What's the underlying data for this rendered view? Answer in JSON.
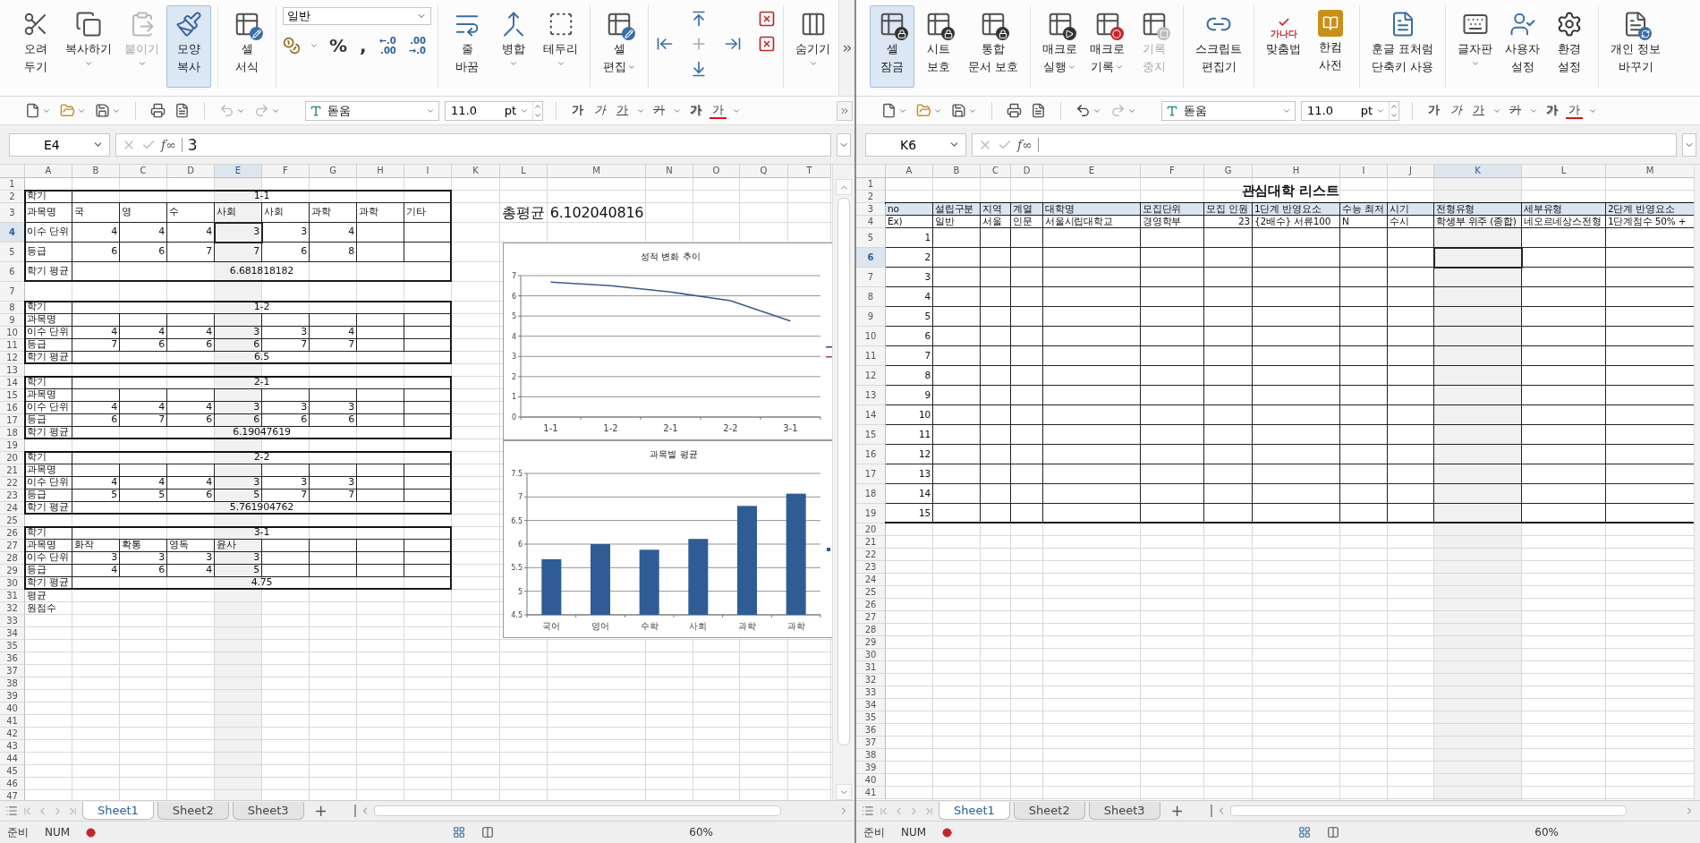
{
  "panes": [
    {
      "ribbon": {
        "groups": [
          {
            "items": [
              {
                "kind": "button",
                "lines": [
                  "오려",
                  "두기"
                ],
                "caret_below": false,
                "caret_inline": false,
                "selected": false,
                "disabled": false
              },
              {
                "kind": "button",
                "lines": [
                  "복사하기"
                ],
                "caret_below": true,
                "caret_inline": false,
                "selected": false,
                "disabled": false
              },
              {
                "kind": "button",
                "lines": [
                  "붙이기"
                ],
                "caret_below": true,
                "caret_inline": false,
                "selected": false,
                "disabled": true
              },
              {
                "kind": "button",
                "lines": [
                  "모양",
                  "복사"
                ],
                "caret_below": false,
                "caret_inline": false,
                "selected": true,
                "disabled": false
              }
            ]
          },
          {
            "items": [
              {
                "kind": "button",
                "lines": [
                  "셀",
                  "서식"
                ],
                "caret_below": false,
                "caret_inline": false,
                "selected": false,
                "disabled": false
              }
            ]
          },
          {
            "items": [
              {
                "kind": "number-format",
                "format": "일반",
                "symbols": [
                  "%",
                  ","
                ],
                "decimals": [
                  {
                    "top": "←.0",
                    "bottom": ".00"
                  },
                  {
                    "top": ".00",
                    "bottom": "→.0"
                  }
                ]
              }
            ]
          },
          {
            "items": [
              {
                "kind": "button",
                "lines": [
                  "줄",
                  "바꿈"
                ],
                "caret_below": false,
                "caret_inline": false,
                "selected": false,
                "disabled": false
              },
              {
                "kind": "button",
                "lines": [
                  "병합"
                ],
                "caret_below": true,
                "caret_inline": false,
                "selected": false,
                "disabled": false
              },
              {
                "kind": "button",
                "lines": [
                  "테두리"
                ],
                "caret_below": true,
                "caret_inline": false,
                "selected": false,
                "disabled": false
              }
            ]
          },
          {
            "items": [
              {
                "kind": "button",
                "lines": [
                  "셀",
                  "편집"
                ],
                "caret_below": false,
                "caret_inline": true,
                "selected": false,
                "disabled": false
              }
            ]
          },
          {
            "items": [
              {
                "kind": "insert-delete-grid"
              }
            ]
          },
          {
            "items": [
              {
                "kind": "button",
                "lines": [
                  "숨기기"
                ],
                "caret_below": true,
                "caret_inline": false,
                "selected": false,
                "disabled": false
              }
            ]
          }
        ],
        "overflow_button": true
      },
      "toolbar": {
        "undo": {
          "disabled": true
        },
        "redo": {
          "disabled": true
        },
        "font": "돋움",
        "size": "11.0",
        "unit": "pt",
        "overflow_button": true,
        "styles": [
          {
            "kind": "bold",
            "label": "가"
          },
          {
            "kind": "italic",
            "label": "가"
          },
          {
            "kind": "underline",
            "label": "가"
          },
          {
            "kind": "strike",
            "label": "가"
          },
          {
            "kind": "shadow",
            "label": "가"
          },
          {
            "kind": "color",
            "label": "가"
          }
        ]
      },
      "formula_bar": {
        "cell": "E4",
        "function_label": "f∞",
        "value": "3"
      },
      "sheet": {
        "kind": "grades",
        "columns": [
          {
            "label": "A",
            "selected": false
          },
          {
            "label": "B",
            "selected": false
          },
          {
            "label": "C",
            "selected": false
          },
          {
            "label": "D",
            "selected": false
          },
          {
            "label": "E",
            "selected": true
          },
          {
            "label": "F",
            "selected": false
          },
          {
            "label": "G",
            "selected": false
          },
          {
            "label": "H",
            "selected": false
          },
          {
            "label": "I",
            "selected": false
          },
          {
            "label": "K",
            "selected": false
          },
          {
            "label": "L",
            "selected": false
          },
          {
            "label": "M",
            "selected": false
          },
          {
            "label": "N",
            "selected": false
          },
          {
            "label": "O",
            "selected": false
          },
          {
            "label": "Q",
            "selected": false
          },
          {
            "label": "T",
            "selected": false
          }
        ],
        "row_headers": [
          {
            "label": "1",
            "selected": false
          },
          {
            "label": "2",
            "selected": false
          },
          {
            "label": "3",
            "selected": false
          },
          {
            "label": "4",
            "selected": true
          },
          {
            "label": "5",
            "selected": false
          },
          {
            "label": "6",
            "selected": false
          },
          {
            "label": "7",
            "selected": false
          },
          {
            "label": "8",
            "selected": false
          },
          {
            "label": "9",
            "selected": false
          },
          {
            "label": "10",
            "selected": false
          },
          {
            "label": "11",
            "selected": false
          },
          {
            "label": "12",
            "selected": false
          },
          {
            "label": "13",
            "selected": false
          },
          {
            "label": "14",
            "selected": false
          },
          {
            "label": "15",
            "selected": false
          },
          {
            "label": "16",
            "selected": false
          },
          {
            "label": "17",
            "selected": false
          },
          {
            "label": "18",
            "selected": false
          },
          {
            "label": "19",
            "selected": false
          },
          {
            "label": "20",
            "selected": false
          },
          {
            "label": "21",
            "selected": false
          },
          {
            "label": "22",
            "selected": false
          },
          {
            "label": "23",
            "selected": false
          },
          {
            "label": "24",
            "selected": false
          },
          {
            "label": "25",
            "selected": false
          },
          {
            "label": "26",
            "selected": false
          },
          {
            "label": "27",
            "selected": false
          },
          {
            "label": "28",
            "selected": false
          },
          {
            "label": "29",
            "selected": false
          },
          {
            "label": "30",
            "selected": false
          },
          {
            "label": "31",
            "selected": false
          },
          {
            "label": "32",
            "selected": false
          },
          {
            "label": "33",
            "selected": false
          },
          {
            "label": "34",
            "selected": false
          },
          {
            "label": "35",
            "selected": false
          },
          {
            "label": "36",
            "selected": false
          },
          {
            "label": "37",
            "selected": false
          },
          {
            "label": "38",
            "selected": false
          },
          {
            "label": "39",
            "selected": false
          },
          {
            "label": "40",
            "selected": false
          },
          {
            "label": "41",
            "selected": false
          },
          {
            "label": "42",
            "selected": false
          },
          {
            "label": "43",
            "selected": false
          },
          {
            "label": "44",
            "selected": false
          },
          {
            "label": "45",
            "selected": false
          },
          {
            "label": "46",
            "selected": false
          },
          {
            "label": "47",
            "selected": false
          }
        ],
        "blocks": [
          {
            "header": "학기",
            "semester": "1-1",
            "subject_label": "과목명",
            "subjects": [
              "국",
              "영",
              "수",
              "사회",
              "사회",
              "과학",
              "과학",
              "기타"
            ],
            "rows": [
              {
                "label": "이수 단위",
                "values": [
                  "4",
                  "4",
                  "4",
                  "3",
                  "3",
                  "4"
                ]
              },
              {
                "label": "등급",
                "values": [
                  "6",
                  "6",
                  "7",
                  "7",
                  "6",
                  "8"
                ]
              }
            ],
            "avg_label": "학기 평균",
            "average": "6.681818182"
          },
          {
            "header": "학기",
            "semester": "1-2",
            "subject_label": "과목명",
            "rows": [
              {
                "label": "이수 단위",
                "values": [
                  "4",
                  "4",
                  "4",
                  "3",
                  "3",
                  "4"
                ]
              },
              {
                "label": "등급",
                "values": [
                  "7",
                  "6",
                  "6",
                  "6",
                  "7",
                  "7"
                ]
              }
            ],
            "avg_label": "학기 평균",
            "average": "6.5"
          },
          {
            "header": "학기",
            "semester": "2-1",
            "subject_label": "과목명",
            "rows": [
              {
                "label": "이수 단위",
                "values": [
                  "4",
                  "4",
                  "4",
                  "3",
                  "3",
                  "3"
                ]
              },
              {
                "label": "등급",
                "values": [
                  "6",
                  "7",
                  "6",
                  "6",
                  "6",
                  "6"
                ]
              }
            ],
            "avg_label": "학기 평균",
            "average": "6.19047619"
          },
          {
            "header": "학기",
            "semester": "2-2",
            "subject_label": "과목명",
            "rows": [
              {
                "label": "이수 단위",
                "values": [
                  "4",
                  "4",
                  "4",
                  "3",
                  "3",
                  "3"
                ]
              },
              {
                "label": "등급",
                "values": [
                  "5",
                  "5",
                  "6",
                  "5",
                  "7",
                  "7"
                ]
              }
            ],
            "avg_label": "학기 평균",
            "average": "5.761904762"
          },
          {
            "header": "학기",
            "semester": "3-1",
            "subject_label": "과목명",
            "subjects": [
              "화작",
              "확통",
              "영독",
              "윤사"
            ],
            "rows": [
              {
                "label": "이수 단위",
                "values": [
                  "3",
                  "3",
                  "3",
                  "3"
                ]
              },
              {
                "label": "등급",
                "values": [
                  "4",
                  "6",
                  "4",
                  "5"
                ]
              }
            ],
            "avg_label": "학기 평균",
            "average": "4.75"
          }
        ],
        "total": {
          "label": "총평균",
          "value": "6.102040816"
        },
        "footer_labels": [
          "평균",
          "원점수"
        ],
        "charts": [
          {
            "chart_data": {
              "type": "line",
              "title": "성적 변화 추이",
              "categories": [
                "1-1",
                "1-2",
                "2-1",
                "2-2",
                "3-1"
              ],
              "ylim": [
                0,
                7
              ],
              "yticks": [
                0,
                1,
                2,
                3,
                4,
                5,
                6,
                7
              ],
              "grid": true,
              "series": [
                {
                  "color": "#3b5b8c",
                  "values": [
                    6.68,
                    6.5,
                    6.19,
                    5.76,
                    4.75
                  ]
                },
                {
                  "color": "#b0504d",
                  "values": [
                    null,
                    null,
                    null,
                    null,
                    null
                  ]
                }
              ]
            }
          },
          {
            "chart_data": {
              "type": "bar",
              "title": "과목별 평균",
              "categories": [
                "국어",
                "영어",
                "수학",
                "사회",
                "과학",
                "과학"
              ],
              "ylim": [
                4.5,
                7.5
              ],
              "yticks": [
                4.5,
                5,
                5.5,
                6,
                6.5,
                7,
                7.5
              ],
              "grid": true,
              "series": [
                {
                  "color": "#2f5c94",
                  "values": [
                    5.68,
                    6.0,
                    5.88,
                    6.11,
                    6.81,
                    7.07
                  ]
                }
              ]
            }
          }
        ]
      },
      "tabs": {
        "sheets": [
          {
            "label": "Sheet1",
            "selected": true
          },
          {
            "label": "Sheet2",
            "selected": false
          },
          {
            "label": "Sheet3",
            "selected": false
          }
        ],
        "add_label": "+"
      },
      "status": {
        "mode": "준비",
        "num": "NUM",
        "zoom": "60%"
      }
    },
    {
      "ribbon": {
        "groups": [
          {
            "items": [
              {
                "kind": "button",
                "lines": [
                  "셀",
                  "잠금"
                ],
                "caret_below": false,
                "caret_inline": false,
                "selected": true,
                "disabled": false
              },
              {
                "kind": "button",
                "lines": [
                  "시트",
                  "보호"
                ],
                "caret_below": false,
                "caret_inline": false,
                "selected": false,
                "disabled": false
              },
              {
                "kind": "button",
                "lines": [
                  "통합",
                  "문서 보호"
                ],
                "caret_below": false,
                "caret_inline": false,
                "selected": false,
                "disabled": false
              }
            ]
          },
          {
            "items": [
              {
                "kind": "button",
                "lines": [
                  "매크로",
                  "실행"
                ],
                "caret_below": false,
                "caret_inline": true,
                "selected": false,
                "disabled": false
              },
              {
                "kind": "button",
                "lines": [
                  "매크로",
                  "기록"
                ],
                "caret_below": false,
                "caret_inline": true,
                "selected": false,
                "disabled": false
              },
              {
                "kind": "button",
                "lines": [
                  "기록",
                  "중지"
                ],
                "caret_below": false,
                "caret_inline": false,
                "selected": false,
                "disabled": true
              }
            ]
          },
          {
            "items": [
              {
                "kind": "button",
                "lines": [
                  "스크립트",
                  "편집기"
                ],
                "caret_below": false,
                "caret_inline": false,
                "selected": false,
                "disabled": false
              }
            ]
          },
          {
            "items": [
              {
                "kind": "button",
                "lines": [
                  "맞춤법"
                ],
                "icon_text": "가나다",
                "caret_below": false,
                "caret_inline": false,
                "selected": false,
                "disabled": false
              },
              {
                "kind": "button",
                "lines": [
                  "한컴",
                  "사전"
                ],
                "caret_below": false,
                "caret_inline": false,
                "selected": false,
                "disabled": false
              }
            ]
          },
          {
            "items": [
              {
                "kind": "button",
                "lines": [
                  "훈글 표처럼",
                  "단축키 사용"
                ],
                "caret_below": false,
                "caret_inline": false,
                "selected": false,
                "disabled": false
              }
            ]
          },
          {
            "items": [
              {
                "kind": "button",
                "lines": [
                  "글자판"
                ],
                "caret_below": true,
                "caret_inline": false,
                "selected": false,
                "disabled": false
              },
              {
                "kind": "button",
                "lines": [
                  "사용자",
                  "설정"
                ],
                "caret_below": false,
                "caret_inline": false,
                "selected": false,
                "disabled": false
              },
              {
                "kind": "button",
                "lines": [
                  "환경",
                  "설정"
                ],
                "caret_below": false,
                "caret_inline": false,
                "selected": false,
                "disabled": false
              }
            ]
          },
          {
            "items": [
              {
                "kind": "button",
                "lines": [
                  "개인 정보",
                  "바꾸기"
                ],
                "caret_below": false,
                "caret_inline": false,
                "selected": false,
                "disabled": false
              }
            ]
          }
        ]
      },
      "toolbar": {
        "undo": {
          "disabled": false
        },
        "redo": {
          "disabled": true
        },
        "font": "돋움",
        "size": "11.0",
        "unit": "pt",
        "styles": [
          {
            "kind": "bold",
            "label": "가"
          },
          {
            "kind": "italic",
            "label": "가"
          },
          {
            "kind": "underline",
            "label": "가"
          },
          {
            "kind": "strike",
            "label": "가"
          },
          {
            "kind": "shadow",
            "label": "가"
          },
          {
            "kind": "color",
            "label": "가"
          }
        ]
      },
      "formula_bar": {
        "cell": "K6",
        "function_label": "f∞"
      },
      "sheet": {
        "kind": "list",
        "columns": [
          {
            "label": "A",
            "selected": false
          },
          {
            "label": "B",
            "selected": false
          },
          {
            "label": "C",
            "selected": false
          },
          {
            "label": "D",
            "selected": false
          },
          {
            "label": "E",
            "selected": false
          },
          {
            "label": "F",
            "selected": false
          },
          {
            "label": "G",
            "selected": false
          },
          {
            "label": "H",
            "selected": false
          },
          {
            "label": "I",
            "selected": false
          },
          {
            "label": "J",
            "selected": false
          },
          {
            "label": "K",
            "selected": true
          },
          {
            "label": "L",
            "selected": false
          },
          {
            "label": "M",
            "selected": false
          }
        ],
        "row_headers": [
          {
            "label": "1",
            "selected": false
          },
          {
            "label": "2",
            "selected": false
          },
          {
            "label": "3",
            "selected": false
          },
          {
            "label": "4",
            "selected": false
          },
          {
            "label": "5",
            "selected": false
          },
          {
            "label": "6",
            "selected": true
          },
          {
            "label": "7",
            "selected": false
          },
          {
            "label": "8",
            "selected": false
          },
          {
            "label": "9",
            "selected": false
          },
          {
            "label": "10",
            "selected": false
          },
          {
            "label": "11",
            "selected": false
          },
          {
            "label": "12",
            "selected": false
          },
          {
            "label": "13",
            "selected": false
          },
          {
            "label": "14",
            "selected": false
          },
          {
            "label": "15",
            "selected": false
          },
          {
            "label": "16",
            "selected": false
          },
          {
            "label": "17",
            "selected": false
          },
          {
            "label": "18",
            "selected": false
          },
          {
            "label": "19",
            "selected": false
          },
          {
            "label": "20",
            "selected": false
          },
          {
            "label": "21",
            "selected": false
          },
          {
            "label": "22",
            "selected": false
          },
          {
            "label": "23",
            "selected": false
          },
          {
            "label": "24",
            "selected": false
          },
          {
            "label": "25",
            "selected": false
          },
          {
            "label": "26",
            "selected": false
          },
          {
            "label": "27",
            "selected": false
          },
          {
            "label": "28",
            "selected": false
          },
          {
            "label": "29",
            "selected": false
          },
          {
            "label": "30",
            "selected": false
          },
          {
            "label": "31",
            "selected": false
          },
          {
            "label": "32",
            "selected": false
          },
          {
            "label": "33",
            "selected": false
          },
          {
            "label": "34",
            "selected": false
          },
          {
            "label": "35",
            "selected": false
          },
          {
            "label": "36",
            "selected": false
          },
          {
            "label": "37",
            "selected": false
          },
          {
            "label": "38",
            "selected": false
          },
          {
            "label": "39",
            "selected": false
          },
          {
            "label": "40",
            "selected": false
          },
          {
            "label": "41",
            "selected": false
          }
        ],
        "title": "관심대학 리스트",
        "header_row": [
          "no",
          "설립구분",
          "지역",
          "계열",
          "대학명",
          "모집단위",
          "모집 인원",
          "1단계 반영요소",
          "수능 최저",
          "시기",
          "전형유형",
          "세부유형",
          "2단계 반영요소"
        ],
        "example_row": [
          {
            "kind": "text",
            "text": "Ex)"
          },
          {
            "kind": "text",
            "text": "일반"
          },
          {
            "kind": "text",
            "text": "서울"
          },
          {
            "kind": "text",
            "text": "인문"
          },
          {
            "kind": "text",
            "text": "서울시립대학교"
          },
          {
            "kind": "text",
            "text": "경영학부"
          },
          {
            "kind": "number",
            "text": "23"
          },
          {
            "kind": "text",
            "text": "{2배수} 서류100"
          },
          {
            "kind": "text",
            "text": "N"
          },
          {
            "kind": "text",
            "text": "수시"
          },
          {
            "kind": "text",
            "text": "학생부 위주 (종합)"
          },
          {
            "kind": "text",
            "text": "네오르네상스전형"
          },
          {
            "kind": "text",
            "text": "1단계점수 50% +"
          }
        ],
        "numbered_rows": [
          "1",
          "2",
          "3",
          "4",
          "5",
          "6",
          "7",
          "8",
          "9",
          "10",
          "11",
          "12",
          "13",
          "14",
          "15"
        ]
      },
      "tabs": {
        "sheets": [
          {
            "label": "Sheet1",
            "selected": true
          },
          {
            "label": "Sheet2",
            "selected": false
          },
          {
            "label": "Sheet3",
            "selected": false
          }
        ],
        "add_label": "+"
      },
      "status": {
        "mode": "준비",
        "num": "NUM",
        "zoom": "60%"
      }
    }
  ]
}
